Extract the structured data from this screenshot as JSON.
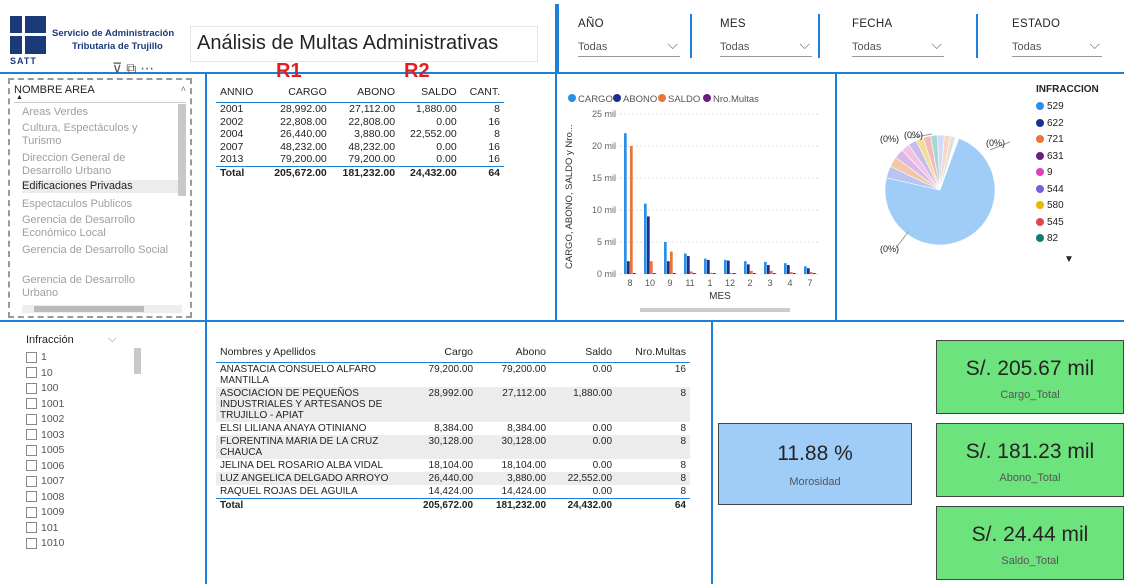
{
  "header": {
    "org_line1": "Servicio de Administración",
    "org_line2": "Tributaria de Trujillo",
    "org_abbr": "SATT",
    "title": "Análisis de Multas Administrativas"
  },
  "filters": [
    {
      "label": "AÑO",
      "value": "Todas"
    },
    {
      "label": "MES",
      "value": "Todas"
    },
    {
      "label": "FECHA",
      "value": "Todas"
    },
    {
      "label": "ESTADO",
      "value": "Todas"
    }
  ],
  "area_slicer": {
    "header": "NOMBRE AREA",
    "items": [
      {
        "label": "Areas Verdes",
        "selected": false
      },
      {
        "label": "Cultura, Espectáculos y Turismo",
        "selected": false
      },
      {
        "label": "Direccion General de Desarrollo Urbano",
        "selected": false
      },
      {
        "label": "Edificaciones Privadas",
        "selected": true
      },
      {
        "label": "Espectaculos Publicos",
        "selected": false
      },
      {
        "label": "Gerencia de Desarrollo Económico Local",
        "selected": false
      },
      {
        "label": "Gerencia de Desarrollo Social",
        "selected": false
      },
      {
        "label": "Gerencia de Desarrollo Urbano",
        "selected": false
      }
    ]
  },
  "annotations": {
    "r1": "R1",
    "r2": "R2"
  },
  "year_table": {
    "columns": [
      "ANNIO",
      "CARGO",
      "ABONO",
      "SALDO",
      "CANT."
    ],
    "rows": [
      [
        "2001",
        "28,992.00",
        "27,112.00",
        "1,880.00",
        "8"
      ],
      [
        "2002",
        "22,808.00",
        "22,808.00",
        "0.00",
        "16"
      ],
      [
        "2004",
        "26,440.00",
        "3,880.00",
        "22,552.00",
        "8"
      ],
      [
        "2007",
        "48,232.00",
        "48,232.00",
        "0.00",
        "16"
      ],
      [
        "2013",
        "79,200.00",
        "79,200.00",
        "0.00",
        "16"
      ]
    ],
    "total": [
      "Total",
      "205,672.00",
      "181,232.00",
      "24,432.00",
      "64"
    ]
  },
  "bar_chart": {
    "legend": [
      "CARGO",
      "ABONO",
      "SALDO",
      "Nro.Multas"
    ],
    "ylabel": "CARGO, ABONO, SALDO y Nro...",
    "xlabel": "MES",
    "ticks": [
      "0 mil",
      "5 mil",
      "10 mil",
      "15 mil",
      "20 mil",
      "25 mil"
    ],
    "colors": {
      "CARGO": "#2b8fe8",
      "ABONO": "#1f2d8c",
      "SALDO": "#e8763a",
      "Nro.Multas": "#6b1f7f"
    }
  },
  "chart_data": {
    "type": "bar",
    "categories": [
      "8",
      "10",
      "9",
      "11",
      "1",
      "12",
      "2",
      "3",
      "4",
      "7"
    ],
    "series": [
      {
        "name": "CARGO",
        "values": [
          22000,
          11000,
          5000,
          3200,
          2400,
          2200,
          2000,
          1900,
          1700,
          1200
        ]
      },
      {
        "name": "ABONO",
        "values": [
          2000,
          9000,
          2000,
          2800,
          2200,
          2100,
          1500,
          1400,
          1400,
          900
        ]
      },
      {
        "name": "SALDO",
        "values": [
          20000,
          2000,
          3500,
          400,
          200,
          100,
          500,
          500,
          300,
          300
        ]
      },
      {
        "name": "Nro.Multas",
        "values": [
          10,
          8,
          8,
          6,
          6,
          6,
          4,
          4,
          4,
          2
        ]
      }
    ],
    "xlabel": "MES",
    "ylabel": "CARGO, ABONO, SALDO y Nro...",
    "ylim": [
      0,
      25000
    ],
    "grid": true,
    "legend_position": "top"
  },
  "pie": {
    "legend_title": "INFRACCION",
    "legend": [
      {
        "label": "529",
        "color": "#2b8fe8"
      },
      {
        "label": "622",
        "color": "#1f2d8c"
      },
      {
        "label": "721",
        "color": "#e8763a"
      },
      {
        "label": "631",
        "color": "#6b1f7f"
      },
      {
        "label": "9",
        "color": "#e040c0"
      },
      {
        "label": "544",
        "color": "#7a5fd6"
      },
      {
        "label": "580",
        "color": "#e6b800"
      },
      {
        "label": "545",
        "color": "#e04850"
      },
      {
        "label": "82",
        "color": "#137a7a"
      }
    ],
    "labels": [
      "(0%)",
      "(0%)",
      "(0%)",
      "(0%)"
    ]
  },
  "infraccion_slicer": {
    "header": "Infracción",
    "items": [
      "1",
      "10",
      "100",
      "1001",
      "1002",
      "1003",
      "1005",
      "1006",
      "1007",
      "1008",
      "1009",
      "101",
      "1010"
    ]
  },
  "person_table": {
    "columns": [
      "Nombres y Apellidos",
      "Cargo",
      "Abono",
      "Saldo",
      "Nro.Multas"
    ],
    "rows": [
      [
        "ANASTACIA CONSUELO ALFARO MANTILLA",
        "79,200.00",
        "79,200.00",
        "0.00",
        "16"
      ],
      [
        "ASOCIACION DE PEQUEÑOS INDUSTRIALES Y ARTESANOS DE TRUJILLO - APIAT",
        "28,992.00",
        "27,112.00",
        "1,880.00",
        "8"
      ],
      [
        "ELSI LILIANA ANAYA OTINIANO",
        "8,384.00",
        "8,384.00",
        "0.00",
        "8"
      ],
      [
        "FLORENTINA MARIA DE LA CRUZ CHAUCA",
        "30,128.00",
        "30,128.00",
        "0.00",
        "8"
      ],
      [
        "JELINA DEL ROSARIO ALBA VIDAL",
        "18,104.00",
        "18,104.00",
        "0.00",
        "8"
      ],
      [
        "LUZ ANGELICA DELGADO ARROYO",
        "26,440.00",
        "3,880.00",
        "22,552.00",
        "8"
      ],
      [
        "RAQUEL ROJAS DEL AGUILA",
        "14,424.00",
        "14,424.00",
        "0.00",
        "8"
      ]
    ],
    "total": [
      "Total",
      "205,672.00",
      "181,232.00",
      "24,432.00",
      "64"
    ]
  },
  "kpis": {
    "morosidad": {
      "value": "11.88 %",
      "label": "Morosidad"
    },
    "cargo": {
      "value": "S/. 205.67 mil",
      "label": "Cargo_Total"
    },
    "abono": {
      "value": "S/. 181.23 mil",
      "label": "Abono_Total"
    },
    "saldo": {
      "value": "S/. 24.44 mil",
      "label": "Saldo_Total"
    }
  }
}
